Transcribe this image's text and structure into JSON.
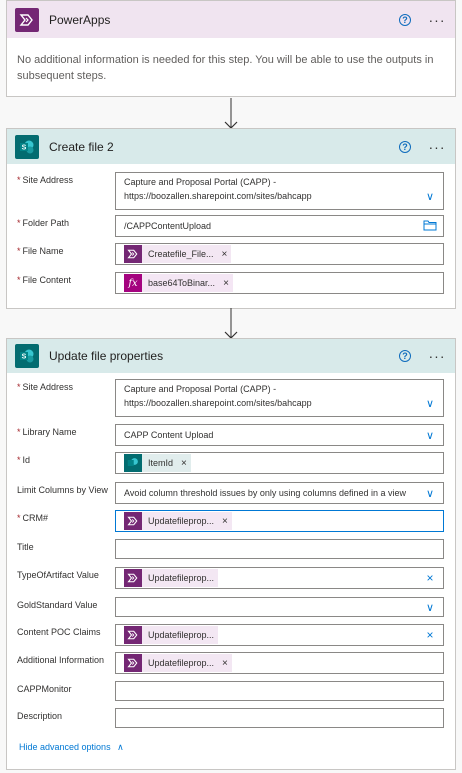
{
  "colors": {
    "powerapps": "#742774",
    "sharepoint": "#036c70",
    "link": "#0078d4"
  },
  "powerapps": {
    "title": "PowerApps",
    "info": "No additional information is needed for this step. You will be able to use the outputs in subsequent steps."
  },
  "create_file": {
    "title": "Create file 2",
    "site_address_label": "Site Address",
    "site_address_line1": "Capture and Proposal Portal (CAPP) -",
    "site_address_line2": "https://boozallen.sharepoint.com/sites/bahcapp",
    "folder_path_label": "Folder Path",
    "folder_path_value": "/CAPPContentUpload",
    "file_name_label": "File Name",
    "file_name_token": "Createfile_File...",
    "file_content_label": "File Content",
    "file_content_token": "base64ToBinar...",
    "fx_symbol": "fx"
  },
  "update_props": {
    "title": "Update file properties",
    "site_address_label": "Site Address",
    "site_address_line1": "Capture and Proposal Portal (CAPP) -",
    "site_address_line2": "https://boozallen.sharepoint.com/sites/bahcapp",
    "library_name_label": "Library Name",
    "library_name_value": "CAPP Content Upload",
    "id_label": "Id",
    "id_token": "ItemId",
    "limit_label": "Limit Columns by View",
    "limit_value": "Avoid column threshold issues by only using columns defined in a view",
    "crm_label": "CRM#",
    "crm_token": "Updatefileprop...",
    "title_label": "Title",
    "type_label": "TypeOfArtifact Value",
    "type_token": "Updatefileprop...",
    "gold_label": "GoldStandard Value",
    "poc_label": "Content POC Claims",
    "poc_token": "Updatefileprop...",
    "addinfo_label": "Additional Information",
    "addinfo_token": "Updatefileprop...",
    "monitor_label": "CAPPMonitor",
    "desc_label": "Description",
    "hide_advanced": "Hide advanced options"
  },
  "common": {
    "help": "?",
    "more": "···",
    "required_mark": "*",
    "remove": "×"
  }
}
